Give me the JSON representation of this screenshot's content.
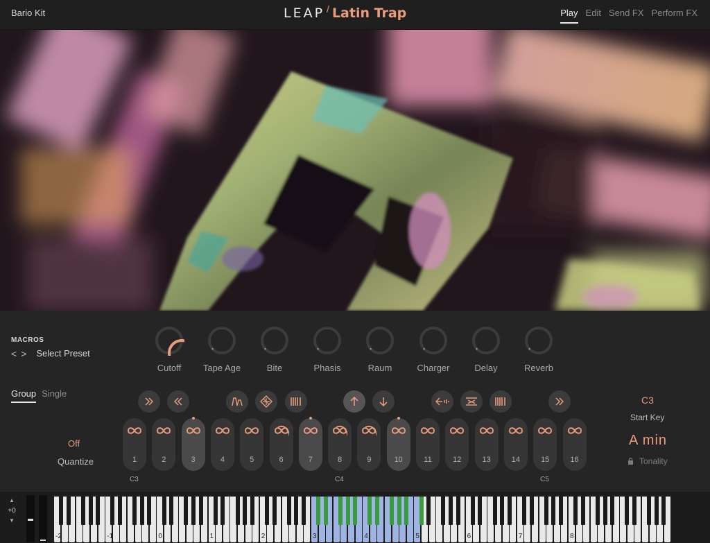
{
  "header": {
    "kit_name": "Bario Kit",
    "brand": "LEAP",
    "brand_slash": "/",
    "product": "Latin Trap",
    "tabs": [
      {
        "label": "Play",
        "active": true
      },
      {
        "label": "Edit",
        "active": false
      },
      {
        "label": "Send FX",
        "active": false
      },
      {
        "label": "Perform FX",
        "active": false
      }
    ]
  },
  "macros": {
    "title": "MACROS",
    "prev_icon": "<",
    "next_icon": ">",
    "preset_label": "Select Preset",
    "knobs": [
      {
        "label": "Cutoff",
        "value": 1.0
      },
      {
        "label": "Tape Age",
        "value": 0.0
      },
      {
        "label": "Bite",
        "value": 0.0
      },
      {
        "label": "Phasis",
        "value": 0.0
      },
      {
        "label": "Raum",
        "value": 0.0
      },
      {
        "label": "Charger",
        "value": 0.0
      },
      {
        "label": "Delay",
        "value": 0.0
      },
      {
        "label": "Reverb",
        "value": 0.0
      }
    ]
  },
  "modes": [
    {
      "label": "Group",
      "active": true
    },
    {
      "label": "Single",
      "active": false
    }
  ],
  "toolbar": [
    {
      "name": "forward-button",
      "icon": "double-chevron-right-icon",
      "lit": false
    },
    {
      "name": "reverse-button",
      "icon": "double-chevron-left-icon",
      "lit": false
    },
    {
      "name": "envelope-button",
      "icon": "envelope-icon",
      "lit": false
    },
    {
      "name": "slice-button",
      "icon": "slice-icon",
      "lit": false
    },
    {
      "name": "bars-button",
      "icon": "bars-icon",
      "lit": false
    },
    {
      "name": "pitch-up-button",
      "icon": "arrow-up-icon",
      "lit": true
    },
    {
      "name": "pitch-down-button",
      "icon": "arrow-down-icon",
      "lit": false
    },
    {
      "name": "stretch-button",
      "icon": "stretch-icon",
      "lit": false
    },
    {
      "name": "swap-button",
      "icon": "swap-icon",
      "lit": false
    },
    {
      "name": "bars2-button",
      "icon": "bars-icon",
      "lit": false
    },
    {
      "name": "next-button",
      "icon": "double-chevron-right-icon",
      "lit": false
    }
  ],
  "quantize": {
    "value": "Off",
    "label": "Quantize"
  },
  "pads": [
    {
      "num": "1",
      "active": false,
      "mode": "loop"
    },
    {
      "num": "2",
      "active": false,
      "mode": "loop"
    },
    {
      "num": "3",
      "active": true,
      "mode": "loop"
    },
    {
      "num": "4",
      "active": false,
      "mode": "loop"
    },
    {
      "num": "5",
      "active": false,
      "mode": "loop"
    },
    {
      "num": "6",
      "active": false,
      "mode": "arc"
    },
    {
      "num": "7",
      "active": true,
      "mode": "loop"
    },
    {
      "num": "8",
      "active": false,
      "mode": "arc"
    },
    {
      "num": "9",
      "active": false,
      "mode": "arc"
    },
    {
      "num": "10",
      "active": true,
      "mode": "loop"
    },
    {
      "num": "11",
      "active": false,
      "mode": "loop"
    },
    {
      "num": "12",
      "active": false,
      "mode": "loop"
    },
    {
      "num": "13",
      "active": false,
      "mode": "loop"
    },
    {
      "num": "14",
      "active": false,
      "mode": "loop"
    },
    {
      "num": "15",
      "active": false,
      "mode": "loop"
    },
    {
      "num": "16",
      "active": false,
      "mode": "loop"
    }
  ],
  "octave_labels": [
    "C3",
    "C4",
    "C5"
  ],
  "start_key": {
    "value": "C3",
    "label": "Start Key"
  },
  "tonality": {
    "value": "A  min",
    "label": "Tonality",
    "lock_icon": "lock-icon"
  },
  "keyboard": {
    "transpose_value": "+0",
    "octave_numbers": [
      "-2",
      "-1",
      "0",
      "1",
      "2",
      "3",
      "4",
      "5",
      "6",
      "7",
      "8"
    ],
    "mapped_range_start_octave": "3",
    "mapped_range_end_octave": "5"
  },
  "colors": {
    "accent": "#e79b7d",
    "mapped_key": "#3a9a3f",
    "range_key": "#9fb4e3",
    "background": "#252525"
  }
}
